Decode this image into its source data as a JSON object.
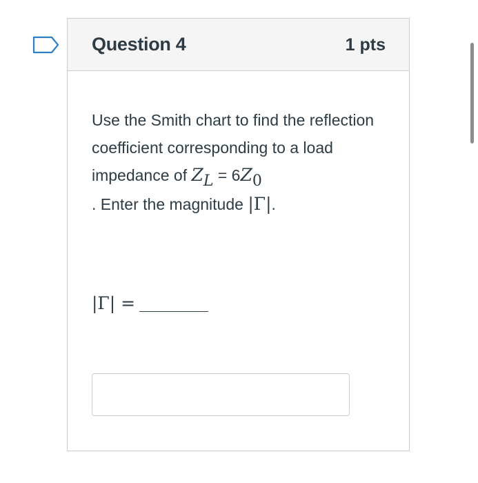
{
  "question": {
    "title": "Question 4",
    "points": "1 pts",
    "text_part1": "Use the Smith chart to find the reflection coefficient corresponding to a load impedance of ",
    "math_Z": "Z",
    "math_L": "L",
    "math_equals": " = 6",
    "math_Z2": "Z",
    "math_0": "0",
    "text_part2": ". Enter the magnitude ",
    "gamma_expr": "|Γ|",
    "text_part3": ".",
    "answer_label": "|Γ| =",
    "answer_value": ""
  },
  "icons": {
    "flag": "flag-outline-icon"
  },
  "colors": {
    "header_bg": "#f5f5f5",
    "border": "#c7cdd1",
    "text": "#2d3b45",
    "flag": "#2d7ec3"
  }
}
